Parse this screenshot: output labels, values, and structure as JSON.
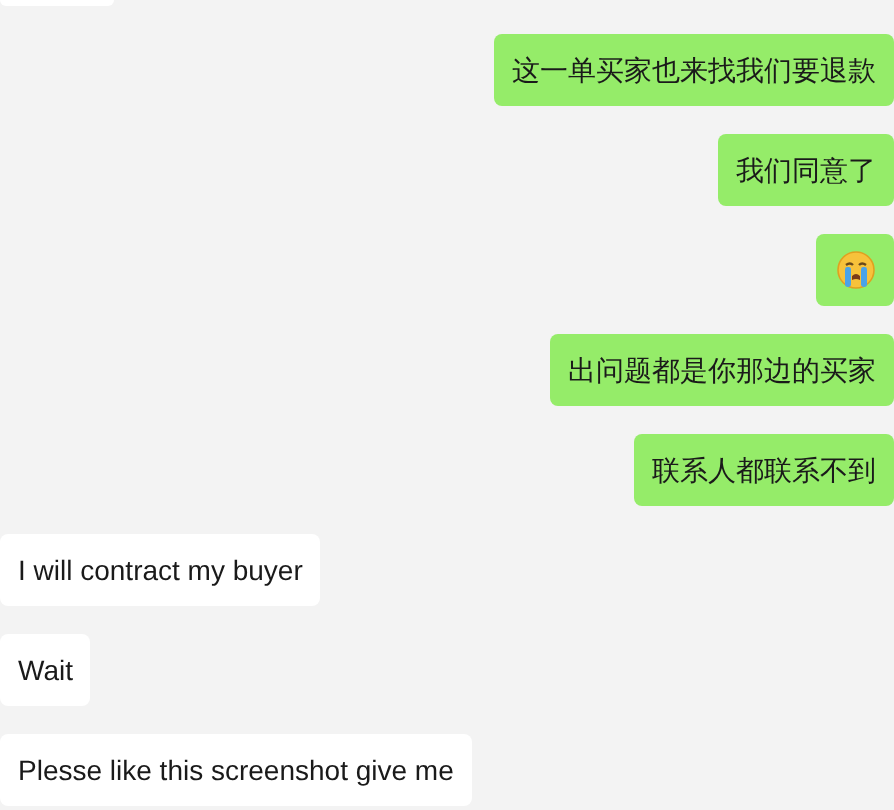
{
  "messages": [
    {
      "outgoing": true,
      "kind": "text",
      "text": "这一单买家也来找我们要退款"
    },
    {
      "outgoing": true,
      "kind": "text",
      "text": "我们同意了"
    },
    {
      "outgoing": true,
      "kind": "emoji"
    },
    {
      "outgoing": true,
      "kind": "text",
      "text": "出问题都是你那边的买家"
    },
    {
      "outgoing": true,
      "kind": "text",
      "text": "联系人都联系不到"
    },
    {
      "outgoing": false,
      "kind": "text",
      "text": "I will contract my buyer"
    },
    {
      "outgoing": false,
      "kind": "text",
      "text": "Wait"
    },
    {
      "outgoing": false,
      "kind": "text",
      "text": "Plesse like this screenshot give me"
    }
  ]
}
